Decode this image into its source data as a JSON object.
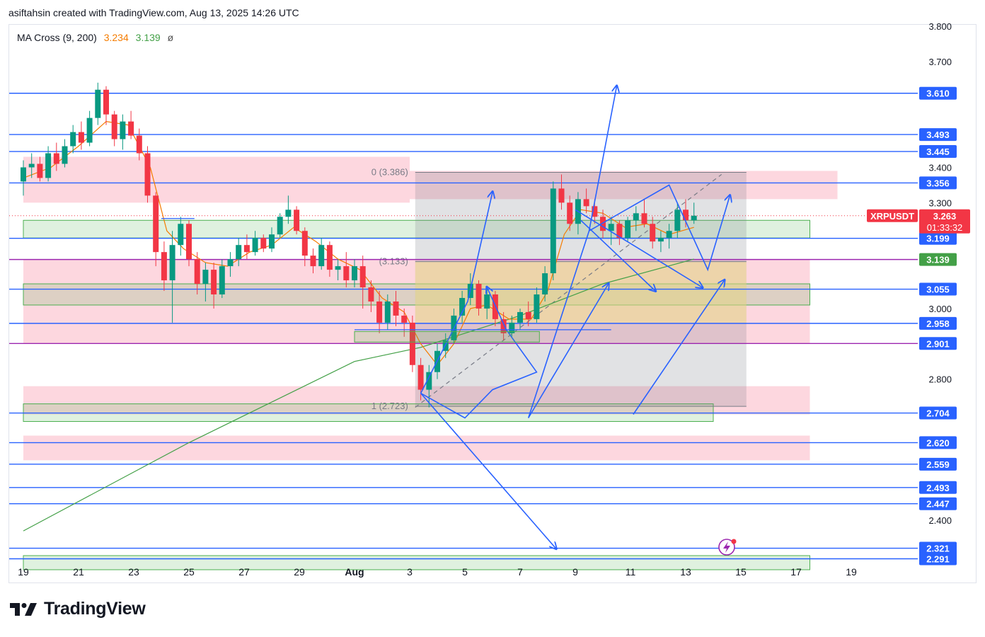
{
  "header": {
    "attribution": "asiftahsin created with TradingView.com, Aug 13, 2025 14:26 UTC"
  },
  "legend": {
    "name": "MA Cross (9, 200)",
    "ma_fast": "3.234",
    "ma_slow": "3.139",
    "glyph": "ø"
  },
  "brand": {
    "name": "TradingView"
  },
  "chart_data": {
    "type": "candlestick",
    "symbol": "XRPUSDT",
    "last_price": "3.263",
    "countdown": "01:33:32",
    "ylim": [
      2.26,
      3.82
    ],
    "y_ticks": [
      "3.800",
      "3.700",
      "3.400",
      "3.300",
      "3.000",
      "2.800",
      "2.400"
    ],
    "x_ticks": [
      {
        "label": "19",
        "day": 0
      },
      {
        "label": "21",
        "day": 2
      },
      {
        "label": "23",
        "day": 4
      },
      {
        "label": "25",
        "day": 6
      },
      {
        "label": "27",
        "day": 8
      },
      {
        "label": "29",
        "day": 10
      },
      {
        "label": "Aug",
        "day": 12
      },
      {
        "label": "3",
        "day": 14
      },
      {
        "label": "5",
        "day": 16
      },
      {
        "label": "7",
        "day": 18
      },
      {
        "label": "9",
        "day": 20
      },
      {
        "label": "11",
        "day": 22
      },
      {
        "label": "13",
        "day": 24
      },
      {
        "label": "15",
        "day": 26
      },
      {
        "label": "17",
        "day": 28
      },
      {
        "label": "19",
        "day": 30
      }
    ],
    "price_levels": [
      {
        "label": "3.610",
        "value": 3.61,
        "color": "#2962ff"
      },
      {
        "label": "3.493",
        "value": 3.493,
        "color": "#2962ff"
      },
      {
        "label": "3.445",
        "value": 3.445,
        "color": "#2962ff"
      },
      {
        "label": "3.356",
        "value": 3.356,
        "color": "#2962ff"
      },
      {
        "label": "3.234",
        "value": 3.234,
        "color": "#f57c00"
      },
      {
        "label": "3.199",
        "value": 3.199,
        "color": "#2962ff"
      },
      {
        "label": "3.139",
        "value": 3.139,
        "color": "#43a047"
      },
      {
        "label": "3.055",
        "value": 3.055,
        "color": "#2962ff"
      },
      {
        "label": "2.958",
        "value": 2.958,
        "color": "#2962ff"
      },
      {
        "label": "2.901",
        "value": 2.901,
        "color": "#2962ff"
      },
      {
        "label": "2.704",
        "value": 2.704,
        "color": "#2962ff"
      },
      {
        "label": "2.620",
        "value": 2.62,
        "color": "#2962ff"
      },
      {
        "label": "2.559",
        "value": 2.559,
        "color": "#2962ff"
      },
      {
        "label": "2.493",
        "value": 2.493,
        "color": "#2962ff"
      },
      {
        "label": "2.447",
        "value": 2.447,
        "color": "#2962ff"
      },
      {
        "label": "2.321",
        "value": 2.321,
        "color": "#2962ff"
      },
      {
        "label": "2.291",
        "value": 2.291,
        "color": "#2962ff"
      }
    ],
    "fib_labels": [
      {
        "text": "0 (3.386)",
        "value": 3.386
      },
      {
        "text": "(3.133)",
        "value": 3.133
      },
      {
        "text": "1 (2.723)",
        "value": 2.723
      }
    ],
    "zones": [
      {
        "from": 3.43,
        "to": 3.3,
        "color": "pink",
        "day_from": 0,
        "day_to": 14
      },
      {
        "from": 3.39,
        "to": 3.31,
        "color": "pink",
        "day_from": 14,
        "day_to": 29.5
      },
      {
        "from": 3.25,
        "to": 3.2,
        "color": "green",
        "day_from": 0,
        "day_to": 28.5
      },
      {
        "from": 3.14,
        "to": 2.9,
        "color": "pink",
        "day_from": 0,
        "day_to": 28.5
      },
      {
        "from": 3.07,
        "to": 3.01,
        "color": "green",
        "day_from": 0,
        "day_to": 28.5
      },
      {
        "from": 2.78,
        "to": 2.7,
        "color": "pink",
        "day_from": 0,
        "day_to": 28.5
      },
      {
        "from": 2.73,
        "to": 2.68,
        "color": "green",
        "day_from": 0,
        "day_to": 25
      },
      {
        "from": 2.64,
        "to": 2.57,
        "color": "pink",
        "day_from": 0,
        "day_to": 28.5
      },
      {
        "from": 2.3,
        "to": 2.26,
        "color": "green",
        "day_from": 0,
        "day_to": 28.5
      }
    ],
    "candles": [
      {
        "d": 0.0,
        "o": 3.36,
        "h": 3.42,
        "l": 3.32,
        "c": 3.4
      },
      {
        "d": 0.3,
        "o": 3.4,
        "h": 3.44,
        "l": 3.37,
        "c": 3.41
      },
      {
        "d": 0.6,
        "o": 3.41,
        "h": 3.43,
        "l": 3.36,
        "c": 3.37
      },
      {
        "d": 0.9,
        "o": 3.37,
        "h": 3.46,
        "l": 3.36,
        "c": 3.44
      },
      {
        "d": 1.2,
        "o": 3.44,
        "h": 3.47,
        "l": 3.39,
        "c": 3.41
      },
      {
        "d": 1.5,
        "o": 3.41,
        "h": 3.48,
        "l": 3.4,
        "c": 3.46
      },
      {
        "d": 1.8,
        "o": 3.46,
        "h": 3.52,
        "l": 3.44,
        "c": 3.5
      },
      {
        "d": 2.1,
        "o": 3.5,
        "h": 3.53,
        "l": 3.45,
        "c": 3.47
      },
      {
        "d": 2.4,
        "o": 3.47,
        "h": 3.56,
        "l": 3.46,
        "c": 3.54
      },
      {
        "d": 2.7,
        "o": 3.54,
        "h": 3.64,
        "l": 3.52,
        "c": 3.62
      },
      {
        "d": 3.0,
        "o": 3.62,
        "h": 3.63,
        "l": 3.52,
        "c": 3.55
      },
      {
        "d": 3.3,
        "o": 3.55,
        "h": 3.56,
        "l": 3.46,
        "c": 3.48
      },
      {
        "d": 3.6,
        "o": 3.48,
        "h": 3.55,
        "l": 3.45,
        "c": 3.53
      },
      {
        "d": 3.9,
        "o": 3.53,
        "h": 3.56,
        "l": 3.48,
        "c": 3.49
      },
      {
        "d": 4.2,
        "o": 3.49,
        "h": 3.51,
        "l": 3.42,
        "c": 3.44
      },
      {
        "d": 4.5,
        "o": 3.44,
        "h": 3.46,
        "l": 3.3,
        "c": 3.32
      },
      {
        "d": 4.8,
        "o": 3.32,
        "h": 3.33,
        "l": 3.12,
        "c": 3.16
      },
      {
        "d": 5.1,
        "o": 3.16,
        "h": 3.19,
        "l": 3.05,
        "c": 3.08
      },
      {
        "d": 5.4,
        "o": 3.08,
        "h": 3.22,
        "l": 2.96,
        "c": 3.18
      },
      {
        "d": 5.7,
        "o": 3.18,
        "h": 3.26,
        "l": 3.15,
        "c": 3.24
      },
      {
        "d": 6.0,
        "o": 3.24,
        "h": 3.25,
        "l": 3.12,
        "c": 3.14
      },
      {
        "d": 6.3,
        "o": 3.14,
        "h": 3.16,
        "l": 3.04,
        "c": 3.07
      },
      {
        "d": 6.6,
        "o": 3.07,
        "h": 3.13,
        "l": 3.02,
        "c": 3.11
      },
      {
        "d": 6.9,
        "o": 3.11,
        "h": 3.13,
        "l": 3.0,
        "c": 3.04
      },
      {
        "d": 7.2,
        "o": 3.04,
        "h": 3.14,
        "l": 3.03,
        "c": 3.12
      },
      {
        "d": 7.5,
        "o": 3.12,
        "h": 3.16,
        "l": 3.09,
        "c": 3.14
      },
      {
        "d": 7.8,
        "o": 3.14,
        "h": 3.2,
        "l": 3.12,
        "c": 3.18
      },
      {
        "d": 8.1,
        "o": 3.18,
        "h": 3.21,
        "l": 3.14,
        "c": 3.16
      },
      {
        "d": 8.4,
        "o": 3.16,
        "h": 3.22,
        "l": 3.15,
        "c": 3.2
      },
      {
        "d": 8.7,
        "o": 3.2,
        "h": 3.21,
        "l": 3.16,
        "c": 3.17
      },
      {
        "d": 9.0,
        "o": 3.17,
        "h": 3.23,
        "l": 3.16,
        "c": 3.21
      },
      {
        "d": 9.3,
        "o": 3.21,
        "h": 3.27,
        "l": 3.2,
        "c": 3.26
      },
      {
        "d": 9.6,
        "o": 3.26,
        "h": 3.32,
        "l": 3.24,
        "c": 3.28
      },
      {
        "d": 9.9,
        "o": 3.28,
        "h": 3.29,
        "l": 3.21,
        "c": 3.22
      },
      {
        "d": 10.2,
        "o": 3.22,
        "h": 3.23,
        "l": 3.12,
        "c": 3.15
      },
      {
        "d": 10.5,
        "o": 3.15,
        "h": 3.17,
        "l": 3.1,
        "c": 3.12
      },
      {
        "d": 10.8,
        "o": 3.12,
        "h": 3.2,
        "l": 3.11,
        "c": 3.18
      },
      {
        "d": 11.1,
        "o": 3.18,
        "h": 3.19,
        "l": 3.09,
        "c": 3.11
      },
      {
        "d": 11.4,
        "o": 3.11,
        "h": 3.14,
        "l": 3.08,
        "c": 3.12
      },
      {
        "d": 11.7,
        "o": 3.12,
        "h": 3.16,
        "l": 3.06,
        "c": 3.08
      },
      {
        "d": 12.0,
        "o": 3.08,
        "h": 3.14,
        "l": 3.06,
        "c": 3.12
      },
      {
        "d": 12.3,
        "o": 3.12,
        "h": 3.15,
        "l": 3.0,
        "c": 3.06
      },
      {
        "d": 12.6,
        "o": 3.06,
        "h": 3.08,
        "l": 2.99,
        "c": 3.02
      },
      {
        "d": 12.9,
        "o": 3.02,
        "h": 3.05,
        "l": 2.93,
        "c": 2.96
      },
      {
        "d": 13.2,
        "o": 2.96,
        "h": 3.04,
        "l": 2.94,
        "c": 3.02
      },
      {
        "d": 13.5,
        "o": 3.02,
        "h": 3.05,
        "l": 2.95,
        "c": 2.98
      },
      {
        "d": 13.8,
        "o": 2.98,
        "h": 3.0,
        "l": 2.92,
        "c": 2.96
      },
      {
        "d": 14.1,
        "o": 2.96,
        "h": 2.98,
        "l": 2.82,
        "c": 2.84
      },
      {
        "d": 14.4,
        "o": 2.84,
        "h": 2.86,
        "l": 2.74,
        "c": 2.77
      },
      {
        "d": 14.7,
        "o": 2.77,
        "h": 2.84,
        "l": 2.72,
        "c": 2.82
      },
      {
        "d": 15.0,
        "o": 2.82,
        "h": 2.9,
        "l": 2.8,
        "c": 2.88
      },
      {
        "d": 15.3,
        "o": 2.88,
        "h": 2.93,
        "l": 2.86,
        "c": 2.91
      },
      {
        "d": 15.6,
        "o": 2.91,
        "h": 3.0,
        "l": 2.9,
        "c": 2.98
      },
      {
        "d": 15.9,
        "o": 2.98,
        "h": 3.05,
        "l": 2.96,
        "c": 3.03
      },
      {
        "d": 16.2,
        "o": 3.03,
        "h": 3.1,
        "l": 3.01,
        "c": 3.07
      },
      {
        "d": 16.5,
        "o": 3.07,
        "h": 3.08,
        "l": 2.98,
        "c": 3.0
      },
      {
        "d": 16.8,
        "o": 3.0,
        "h": 3.06,
        "l": 2.97,
        "c": 3.04
      },
      {
        "d": 17.1,
        "o": 3.04,
        "h": 3.05,
        "l": 2.95,
        "c": 2.97
      },
      {
        "d": 17.4,
        "o": 2.97,
        "h": 2.99,
        "l": 2.91,
        "c": 2.93
      },
      {
        "d": 17.7,
        "o": 2.93,
        "h": 2.98,
        "l": 2.92,
        "c": 2.96
      },
      {
        "d": 18.0,
        "o": 2.96,
        "h": 3.0,
        "l": 2.94,
        "c": 2.99
      },
      {
        "d": 18.3,
        "o": 2.99,
        "h": 3.02,
        "l": 2.95,
        "c": 2.97
      },
      {
        "d": 18.6,
        "o": 2.97,
        "h": 3.06,
        "l": 2.96,
        "c": 3.04
      },
      {
        "d": 18.9,
        "o": 3.04,
        "h": 3.12,
        "l": 3.02,
        "c": 3.1
      },
      {
        "d": 19.2,
        "o": 3.1,
        "h": 3.36,
        "l": 3.08,
        "c": 3.34
      },
      {
        "d": 19.5,
        "o": 3.34,
        "h": 3.38,
        "l": 3.28,
        "c": 3.3
      },
      {
        "d": 19.8,
        "o": 3.3,
        "h": 3.32,
        "l": 3.22,
        "c": 3.24
      },
      {
        "d": 20.1,
        "o": 3.24,
        "h": 3.33,
        "l": 3.21,
        "c": 3.31
      },
      {
        "d": 20.4,
        "o": 3.31,
        "h": 3.34,
        "l": 3.27,
        "c": 3.29
      },
      {
        "d": 20.7,
        "o": 3.29,
        "h": 3.31,
        "l": 3.24,
        "c": 3.26
      },
      {
        "d": 21.0,
        "o": 3.26,
        "h": 3.28,
        "l": 3.2,
        "c": 3.22
      },
      {
        "d": 21.3,
        "o": 3.22,
        "h": 3.26,
        "l": 3.18,
        "c": 3.24
      },
      {
        "d": 21.6,
        "o": 3.24,
        "h": 3.25,
        "l": 3.18,
        "c": 3.2
      },
      {
        "d": 21.9,
        "o": 3.2,
        "h": 3.26,
        "l": 3.19,
        "c": 3.25
      },
      {
        "d": 22.2,
        "o": 3.25,
        "h": 3.29,
        "l": 3.22,
        "c": 3.27
      },
      {
        "d": 22.5,
        "o": 3.27,
        "h": 3.31,
        "l": 3.23,
        "c": 3.24
      },
      {
        "d": 22.8,
        "o": 3.24,
        "h": 3.26,
        "l": 3.17,
        "c": 3.19
      },
      {
        "d": 23.1,
        "o": 3.19,
        "h": 3.22,
        "l": 3.16,
        "c": 3.2
      },
      {
        "d": 23.4,
        "o": 3.2,
        "h": 3.24,
        "l": 3.17,
        "c": 3.22
      },
      {
        "d": 23.7,
        "o": 3.22,
        "h": 3.3,
        "l": 3.2,
        "c": 3.28
      },
      {
        "d": 24.0,
        "o": 3.28,
        "h": 3.31,
        "l": 3.23,
        "c": 3.25
      },
      {
        "d": 24.3,
        "o": 3.25,
        "h": 3.3,
        "l": 3.24,
        "c": 3.263
      }
    ],
    "ma_fast_points": [
      [
        0,
        3.37
      ],
      [
        1,
        3.4
      ],
      [
        2,
        3.46
      ],
      [
        3,
        3.53
      ],
      [
        3.8,
        3.52
      ],
      [
        4.6,
        3.4
      ],
      [
        5.2,
        3.22
      ],
      [
        5.8,
        3.17
      ],
      [
        6.6,
        3.13
      ],
      [
        7.4,
        3.12
      ],
      [
        8.2,
        3.16
      ],
      [
        9.0,
        3.18
      ],
      [
        9.8,
        3.23
      ],
      [
        10.6,
        3.19
      ],
      [
        11.4,
        3.14
      ],
      [
        12.2,
        3.11
      ],
      [
        13.0,
        3.03
      ],
      [
        13.8,
        2.99
      ],
      [
        14.4,
        2.9
      ],
      [
        15.0,
        2.84
      ],
      [
        15.6,
        2.9
      ],
      [
        16.2,
        3.0
      ],
      [
        16.8,
        3.01
      ],
      [
        17.6,
        2.97
      ],
      [
        18.4,
        2.97
      ],
      [
        19.0,
        3.05
      ],
      [
        19.6,
        3.21
      ],
      [
        20.2,
        3.28
      ],
      [
        21.0,
        3.27
      ],
      [
        21.8,
        3.23
      ],
      [
        22.6,
        3.24
      ],
      [
        23.4,
        3.21
      ],
      [
        24.3,
        3.23
      ]
    ],
    "ma_slow_points": [
      [
        0,
        2.37
      ],
      [
        6,
        2.62
      ],
      [
        12,
        2.85
      ],
      [
        14.4,
        2.89
      ],
      [
        18,
        2.98
      ],
      [
        21,
        3.07
      ],
      [
        24.3,
        3.14
      ]
    ],
    "current_line": 3.263
  }
}
